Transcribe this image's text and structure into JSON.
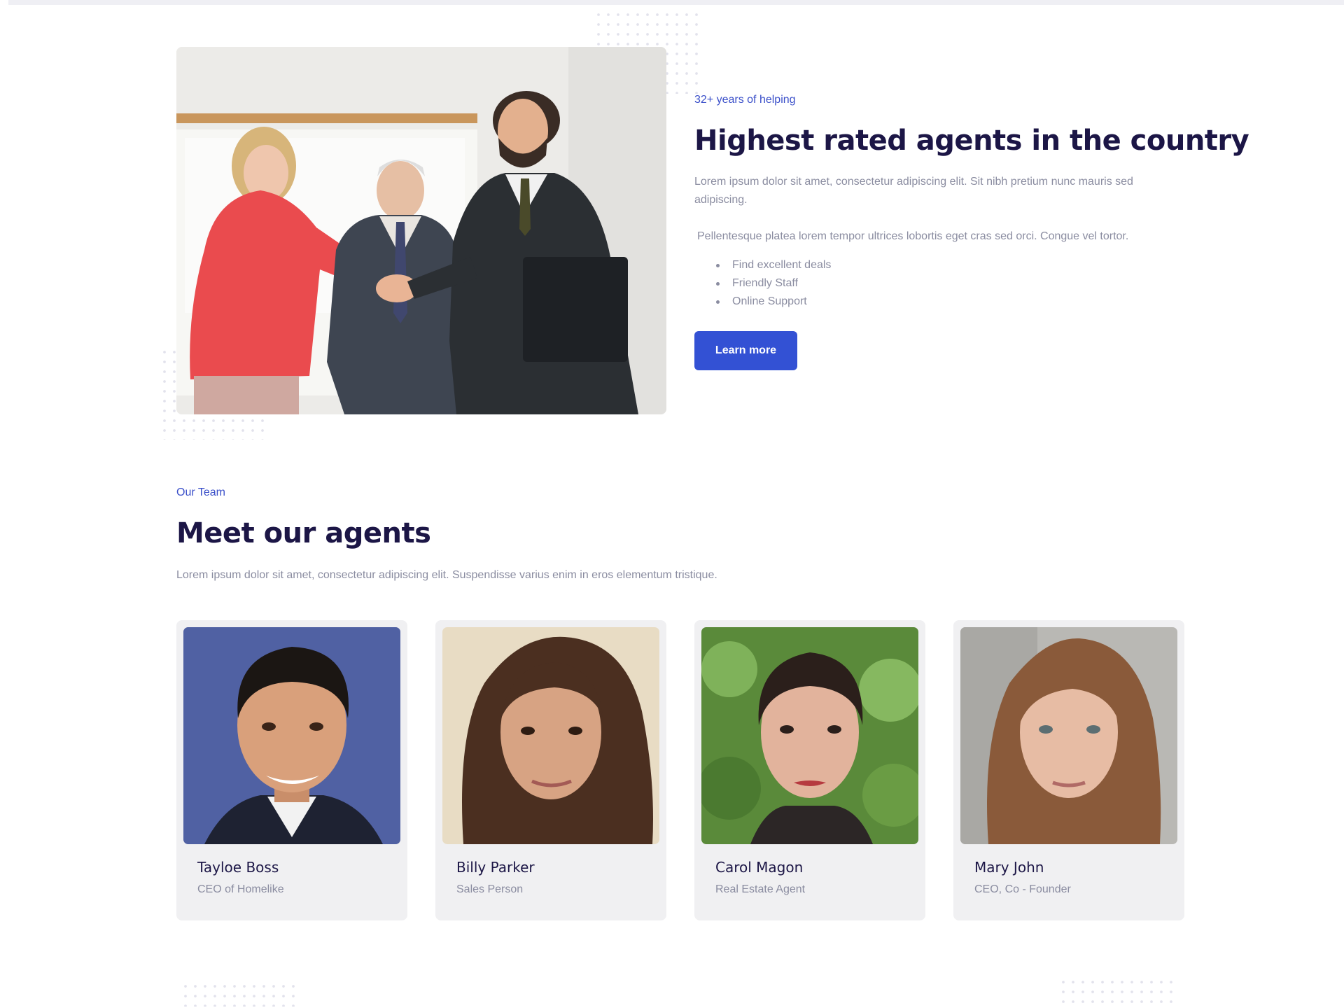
{
  "about": {
    "eyebrow": "32+ years of helping",
    "title": "Highest rated agents in the country",
    "paragraph_1": "Lorem ipsum dolor sit amet, consectetur adipiscing elit. Sit nibh pretium nunc mauris sed adipiscing.",
    "paragraph_2": "Pellentesque platea lorem tempor ultrices lobortis eget cras sed orci. Congue vel tortor.",
    "features": [
      "Find excellent deals",
      "Friendly Staff",
      "Online Support"
    ],
    "cta_label": "Learn more"
  },
  "team": {
    "eyebrow": "Our Team",
    "title": "Meet our agents",
    "description": "Lorem ipsum dolor sit amet, consectetur adipiscing elit. Suspendisse varius enim in eros elementum tristique.",
    "members": [
      {
        "name": "Tayloe Boss",
        "role": "CEO of Homelike"
      },
      {
        "name": "Billy Parker",
        "role": "Sales Person"
      },
      {
        "name": "Carol Magon",
        "role": "Real Estate Agent"
      },
      {
        "name": "Mary John",
        "role": "CEO, Co - Founder"
      }
    ]
  },
  "colors": {
    "accent": "#3351d4",
    "heading": "#1c1646",
    "body_text": "#8a8ca0",
    "card_background": "#f0f0f2"
  }
}
